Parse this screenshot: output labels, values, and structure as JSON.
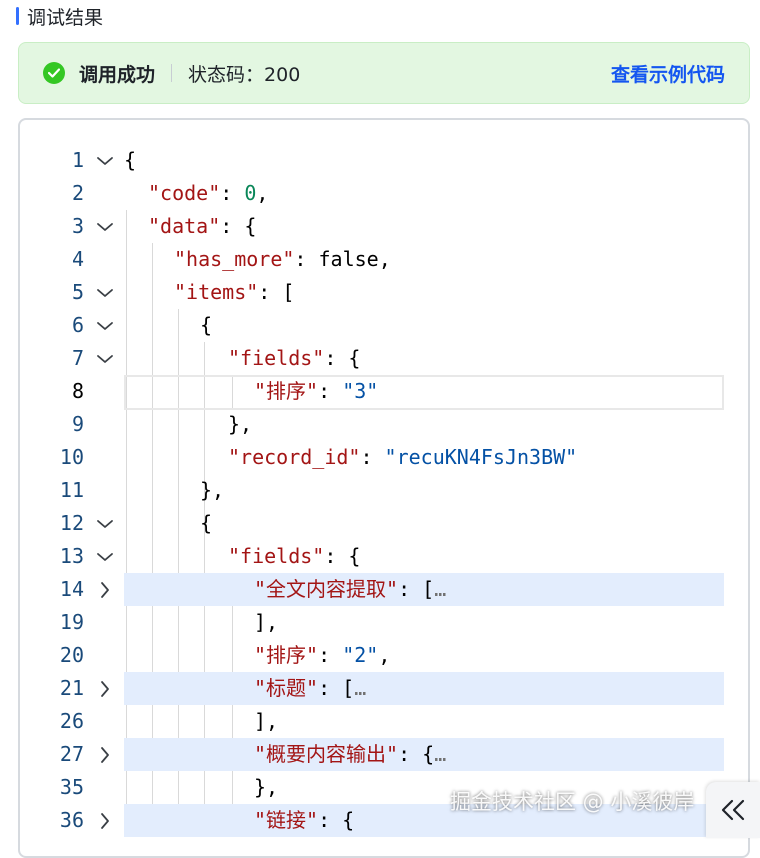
{
  "header": {
    "title": "调试结果"
  },
  "status": {
    "success_label": "调用成功",
    "status_code_text": "状态码：200",
    "example_link": "查看示例代码",
    "accent_color": "#34c724",
    "link_color": "#1456f0"
  },
  "code": {
    "lines": [
      {
        "num": "1",
        "fold": "open",
        "text": "{"
      },
      {
        "num": "2",
        "fold": "",
        "text": "\"code\": 0,"
      },
      {
        "num": "3",
        "fold": "open",
        "text": "\"data\": {"
      },
      {
        "num": "4",
        "fold": "",
        "text": "\"has_more\": false,"
      },
      {
        "num": "5",
        "fold": "open",
        "text": "\"items\": ["
      },
      {
        "num": "6",
        "fold": "open",
        "text": "{"
      },
      {
        "num": "7",
        "fold": "open",
        "text": "\"fields\": {"
      },
      {
        "num": "8",
        "fold": "",
        "text": "\"排序\": \"3\""
      },
      {
        "num": "9",
        "fold": "",
        "text": "},"
      },
      {
        "num": "10",
        "fold": "",
        "text": "\"record_id\": \"recuKN4FsJn3BW\""
      },
      {
        "num": "11",
        "fold": "",
        "text": "},"
      },
      {
        "num": "12",
        "fold": "open",
        "text": "{"
      },
      {
        "num": "13",
        "fold": "open",
        "text": "\"fields\": {"
      },
      {
        "num": "14",
        "fold": "closed",
        "text": "\"全文内容提取\": […"
      },
      {
        "num": "19",
        "fold": "",
        "text": "],"
      },
      {
        "num": "20",
        "fold": "",
        "text": "\"排序\": \"2\","
      },
      {
        "num": "21",
        "fold": "closed",
        "text": "\"标题\": […"
      },
      {
        "num": "26",
        "fold": "",
        "text": "],"
      },
      {
        "num": "27",
        "fold": "closed",
        "text": "\"概要内容输出\": {…"
      },
      {
        "num": "35",
        "fold": "",
        "text": "},"
      },
      {
        "num": "36",
        "fold": "closed",
        "text": "\"链接\": {"
      }
    ]
  },
  "watermark": "掘金技术社区 @ 小溪彼岸"
}
